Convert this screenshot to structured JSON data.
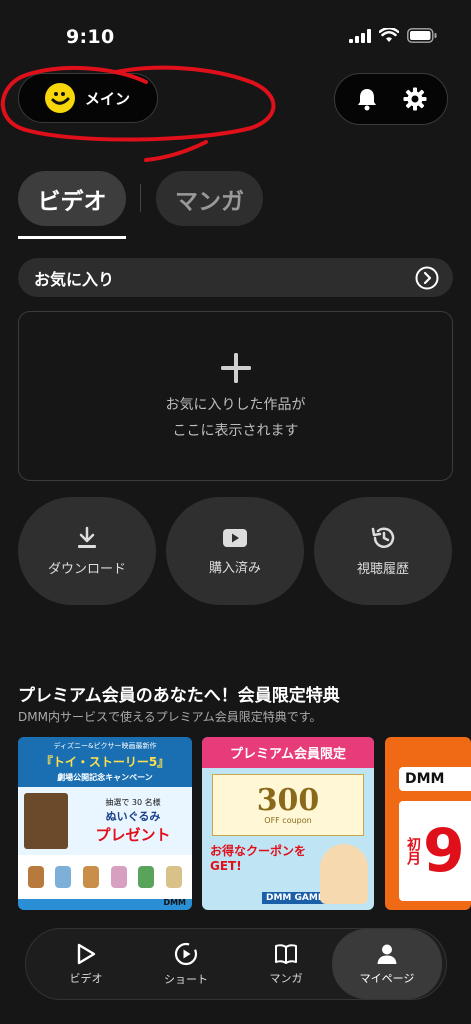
{
  "status_bar": {
    "time": "9:10"
  },
  "account": {
    "label": "メイン"
  },
  "tabs": [
    {
      "label": "ビデオ"
    },
    {
      "label": "マンガ"
    }
  ],
  "favorites": {
    "title": "お気に入り",
    "empty_line1": "お気に入りした作品が",
    "empty_line2": "ここに表示されます"
  },
  "actions": [
    {
      "label": "ダウンロード"
    },
    {
      "label": "購入済み"
    },
    {
      "label": "視聴履歴"
    }
  ],
  "premium": {
    "title": "プレミアム会員のあなたへ！会員限定特典",
    "subtitle": "DMM内サービスで使えるプレミアム会員限定特典です。",
    "banners": [
      {
        "line1": "ディズニー&ピクサー映画最新作",
        "line2": "『トイ・ストーリー5』",
        "line3": "劇場公開記念キャンペーン",
        "line4": "抽選で 30 名様",
        "line5": "ぬいぐるみ",
        "line6": "プレゼント",
        "brand": "DMM"
      },
      {
        "line1": "プレミアム会員限定",
        "line2": "300",
        "line3": "OFF coupon",
        "line4": "お得なクーポンを",
        "line5": "GET!",
        "brand": "DMM GAMES"
      },
      {
        "line1": "DMM",
        "line2": "9",
        "line3": "初月"
      }
    ]
  },
  "bottom_nav": [
    {
      "label": "ビデオ"
    },
    {
      "label": "ショート"
    },
    {
      "label": "マンガ"
    },
    {
      "label": "マイページ"
    }
  ],
  "colors": {
    "accent_yellow": "#f7d70a",
    "annotation_red": "#e0101b",
    "background": "#161616"
  }
}
